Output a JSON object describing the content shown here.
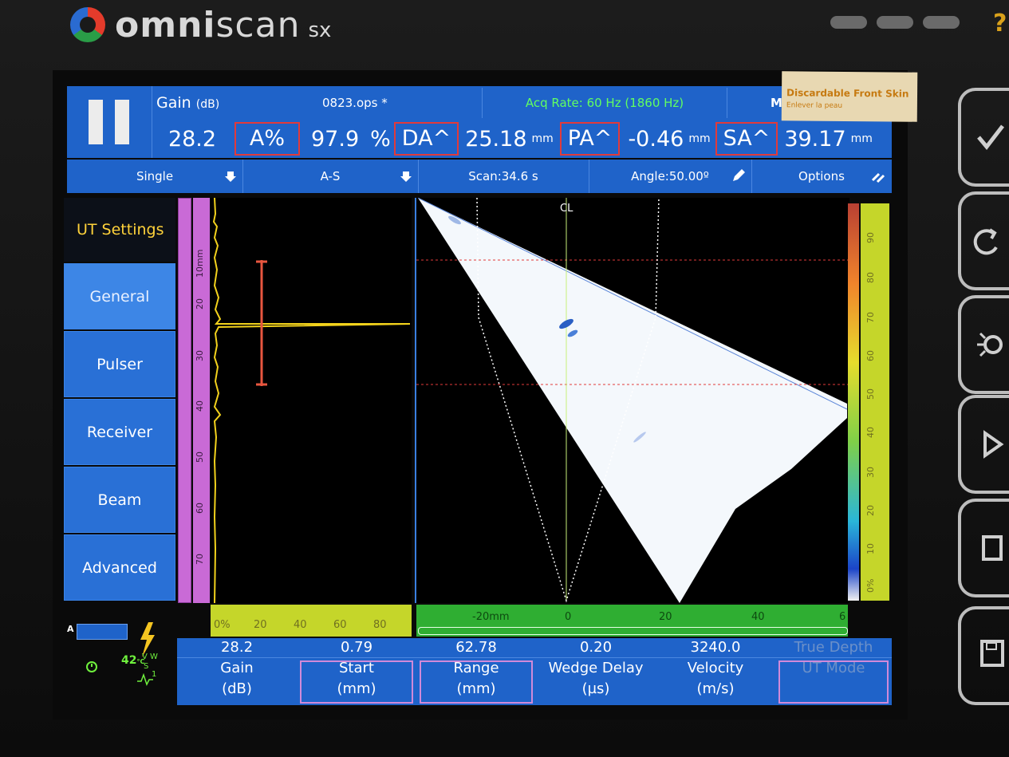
{
  "device": {
    "brand": "omni",
    "brand_suffix": "scan",
    "model": "sx",
    "help": "?"
  },
  "sticker": {
    "title": "Discardable Front Skin",
    "subtitle": "Enlever la peau"
  },
  "header": {
    "gain_label": "Gain",
    "gain_unit": "(dB)",
    "gain_value": "28.2",
    "file": "0823.ops *",
    "acq_rate": "Acq Rate: 60 Hz (1860 Hz)",
    "m_label": "M",
    "readings": [
      {
        "label": "A%",
        "value": "97.9",
        "unit": "%"
      },
      {
        "label": "DA^",
        "value": "25.18",
        "unit": "mm"
      },
      {
        "label": "PA^",
        "value": "-0.46",
        "unit": "mm"
      },
      {
        "label": "SA^",
        "value": "39.17",
        "unit": "mm"
      }
    ]
  },
  "toolbar": {
    "mode": "Single",
    "view": "A-S",
    "scan": "Scan:34.6 s",
    "angle": "Angle:50.00º",
    "options": "Options"
  },
  "menu": {
    "title": "UT Settings",
    "items": [
      "General",
      "Pulser",
      "Receiver",
      "Beam",
      "Advanced"
    ],
    "active": "General"
  },
  "ascan": {
    "depth_ticks": [
      "10mm",
      "20",
      "30",
      "40",
      "50",
      "60",
      "70"
    ],
    "amp_ticks": [
      "0%",
      "20",
      "40",
      "60",
      "80"
    ]
  },
  "sscan": {
    "cl_label": "CL",
    "x_ticks": [
      "-20mm",
      "0",
      "20",
      "40",
      "6"
    ],
    "color_ticks": [
      "90",
      "80",
      "70",
      "60",
      "50",
      "40",
      "30",
      "20",
      "10",
      "0%"
    ]
  },
  "status": {
    "probe_label": "A",
    "temp": "42",
    "temp_unit": "°C",
    "v_label": "V",
    "w_label": "W",
    "s_label": "S",
    "count": "1"
  },
  "params": [
    {
      "value": "28.2",
      "label": "Gain",
      "unit": "(dB)",
      "boxed": false
    },
    {
      "value": "0.79",
      "label": "Start",
      "unit": "(mm)",
      "boxed": true
    },
    {
      "value": "62.78",
      "label": "Range",
      "unit": "(mm)",
      "boxed": true
    },
    {
      "value": "0.20",
      "label": "Wedge Delay",
      "unit": "(µs)",
      "boxed": false
    },
    {
      "value": "3240.0",
      "label": "Velocity",
      "unit": "(m/s)",
      "boxed": false
    },
    {
      "value": "True Depth",
      "label": "UT Mode",
      "unit": "",
      "boxed": true,
      "muted": true
    }
  ],
  "colors": {
    "panel_blue": "#1f63c9",
    "gate_red": "#e23a3a",
    "signal_yellow": "#f2d21c",
    "ruler_purple": "#c96ad6",
    "ruler_lime": "#c5d62a",
    "ruler_green": "#2fae32"
  }
}
